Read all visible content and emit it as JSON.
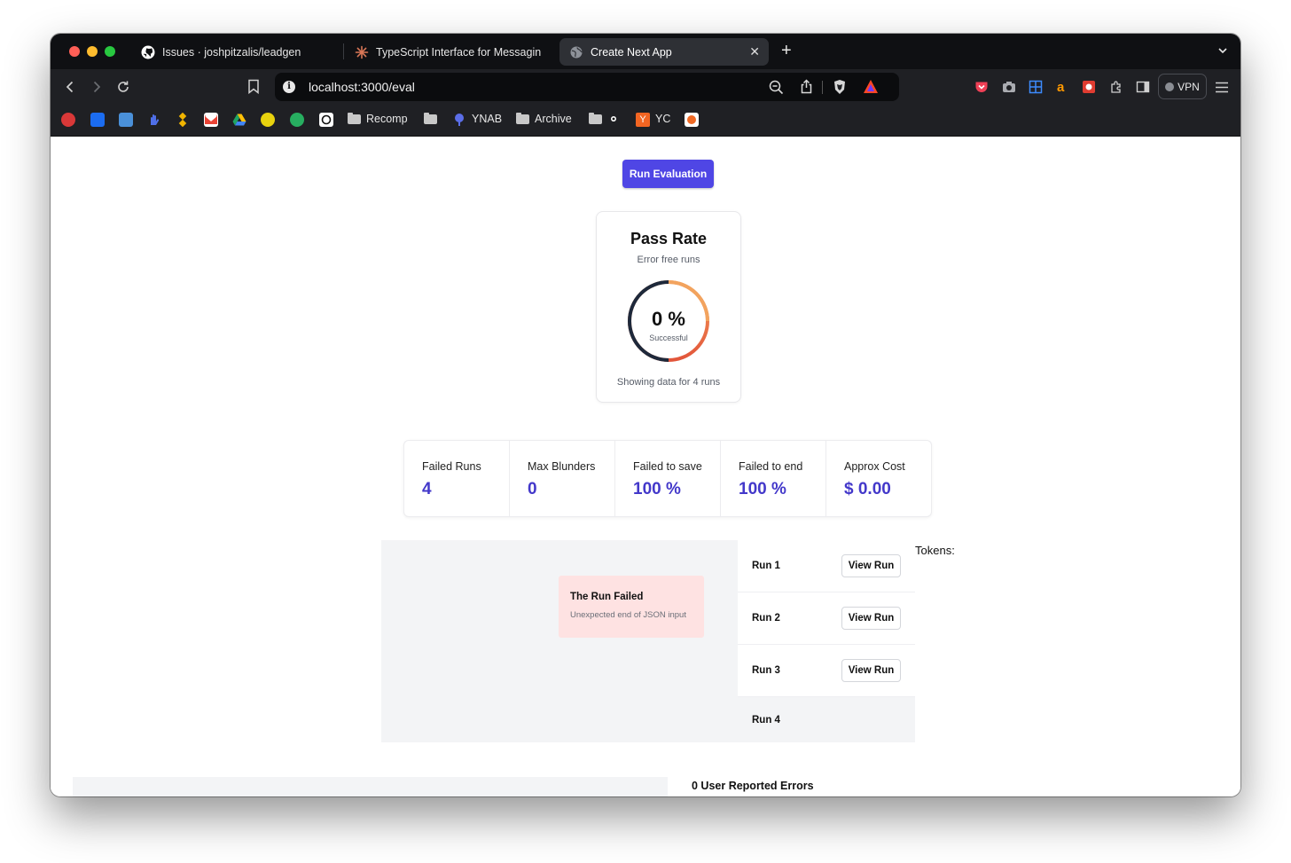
{
  "browser": {
    "tabs": [
      {
        "title": "Issues · joshpitzalis/leadgen",
        "icon": "github-icon"
      },
      {
        "title": "TypeScript Interface for Messagin",
        "icon": "claude-icon"
      },
      {
        "title": "Create Next App",
        "icon": "globe-icon",
        "active": true
      }
    ],
    "new_tab": "+",
    "url": "localhost:3000/eval",
    "vpn_label": "VPN",
    "bookmarks": {
      "recomp": "Recomp",
      "ynab": "YNAB",
      "archive": "Archive",
      "yc": "YC",
      "yc_badge": "Y"
    }
  },
  "colors": {
    "accent": "#4f46e5",
    "stat_value": "#4338ca",
    "ring_start": "#f59e5b",
    "ring_end": "#e2553a",
    "ring_dark": "#1e293b",
    "error_bg": "#fee2e2"
  },
  "main": {
    "run_button": "Run Evaluation",
    "pass_rate": {
      "title": "Pass Rate",
      "subtitle": "Error free runs",
      "percent": "0 %",
      "percent_label": "Successful",
      "footer": "Showing data for 4 runs"
    },
    "stats": [
      {
        "label": "Failed Runs",
        "value": "4"
      },
      {
        "label": "Max Blunders",
        "value": "0"
      },
      {
        "label": "Failed to save",
        "value": "100 %"
      },
      {
        "label": "Failed to end",
        "value": "100 %"
      },
      {
        "label": "Approx Cost",
        "value": "$ 0.00"
      }
    ],
    "error": {
      "title": "The Run Failed",
      "message": "Unexpected end of JSON input"
    },
    "runs": [
      {
        "label": "Run 1",
        "button": "View Run"
      },
      {
        "label": "Run 2",
        "button": "View Run"
      },
      {
        "label": "Run 3",
        "button": "View Run"
      },
      {
        "label": "Run 4"
      }
    ],
    "tokens_label": "Tokens:",
    "user_errors": "0 User Reported Errors"
  }
}
